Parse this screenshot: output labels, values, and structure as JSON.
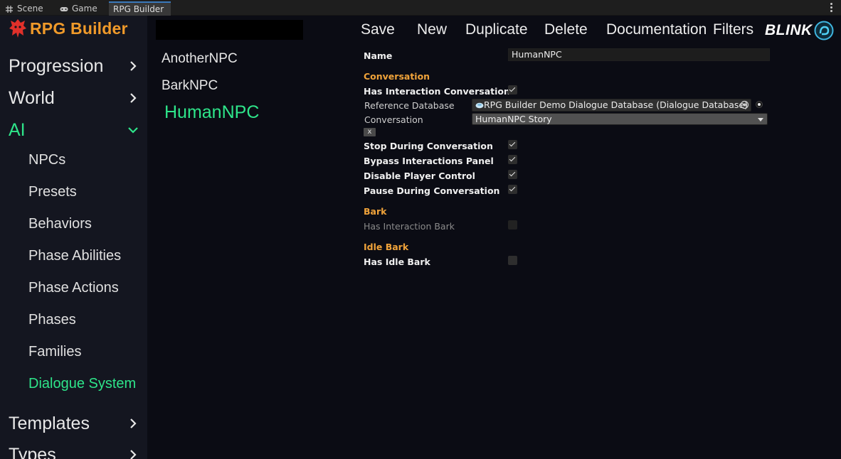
{
  "tabs": {
    "scene": "Scene",
    "game": "Game",
    "rpg_builder": "RPG Builder"
  },
  "logo": {
    "text": "RPG Builder"
  },
  "sidebar": {
    "categories": {
      "progression": "Progression",
      "world": "World",
      "ai": "AI",
      "templates": "Templates",
      "types": "Types"
    },
    "ai_items": [
      "NPCs",
      "Presets",
      "Behaviors",
      "Phase Abilities",
      "Phase Actions",
      "Phases",
      "Families",
      "Dialogue System"
    ]
  },
  "entries": [
    "AnotherNPC",
    "BarkNPC",
    "HumanNPC"
  ],
  "toolbar": {
    "save": "Save",
    "new": "New",
    "duplicate": "Duplicate",
    "delete": "Delete",
    "documentation": "Documentation",
    "filters": "Filters",
    "brand": "BLINK"
  },
  "form": {
    "name_label": "Name",
    "name_value": "HumanNPC",
    "conversation_header": "Conversation",
    "has_interaction_conversation": "Has Interaction Conversation",
    "reference_database_label": "Reference Database",
    "reference_database_value": "RPG Builder Demo Dialogue Database (Dialogue Database)",
    "conversation_label": "Conversation",
    "conversation_value": "HumanNPC Story",
    "clear_button": "x",
    "stop_during_conversation": "Stop During Conversation",
    "bypass_interactions_panel": "Bypass Interactions Panel",
    "disable_player_control": "Disable Player Control",
    "pause_during_conversation": "Pause During Conversation",
    "bark_header": "Bark",
    "has_interaction_bark": "Has Interaction Bark",
    "idle_bark_header": "Idle Bark",
    "has_idle_bark": "Has Idle Bark"
  },
  "checkboxes": {
    "has_interaction_conversation": true,
    "stop_during_conversation": true,
    "bypass_interactions_panel": true,
    "disable_player_control": true,
    "pause_during_conversation": true,
    "has_interaction_bark": false,
    "has_idle_bark": false
  },
  "colors": {
    "accent_green": "#2ee58a",
    "header_orange": "#f0a33a",
    "logo_orange": "#f09a2a",
    "logo_red": "#e0302a"
  }
}
